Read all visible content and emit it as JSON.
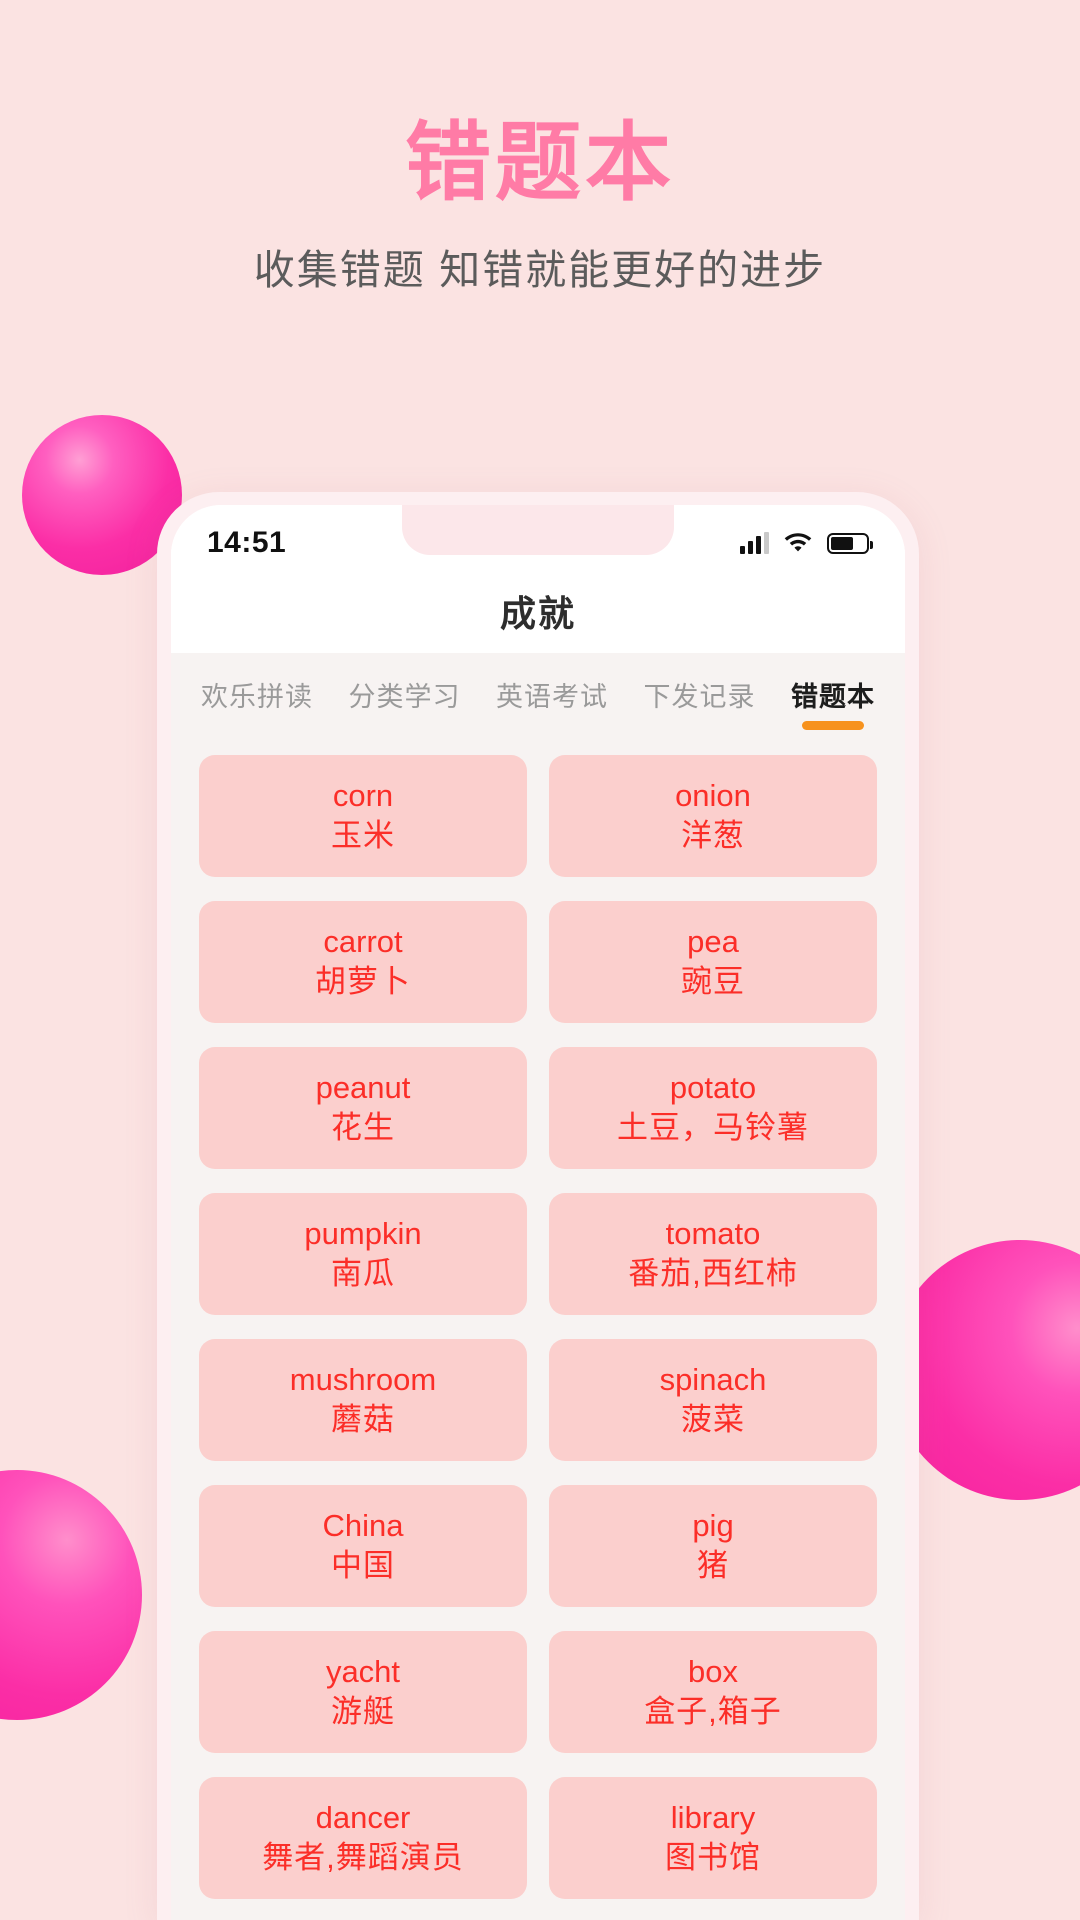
{
  "hero": {
    "title": "错题本",
    "subtitle": "收集错题  知错就能更好的进步",
    "title_color": "#ff7ba6",
    "background_color": "#fbe3e2"
  },
  "decor": {
    "sphere_color": "#fb2ea6",
    "spheres": [
      "sphere-top-left",
      "sphere-right",
      "sphere-bottom-left"
    ]
  },
  "phone": {
    "status_bar": {
      "time": "14:51",
      "signal_icon": "signal-bars-icon",
      "wifi_icon": "wifi-icon",
      "battery_icon": "battery-icon",
      "battery_level": "66%"
    },
    "nav": {
      "title": "成就"
    },
    "tabs": [
      {
        "label": "欢乐拼读",
        "active": false
      },
      {
        "label": "分类学习",
        "active": false
      },
      {
        "label": "英语考试",
        "active": false
      },
      {
        "label": "下发记录",
        "active": false
      },
      {
        "label": "错题本",
        "active": true
      }
    ],
    "tab_accent_color": "#f7921e",
    "card_color": "#fbcfcd",
    "card_text_color": "#fb2e28",
    "words": [
      {
        "en": "corn",
        "cn": "玉米"
      },
      {
        "en": "onion",
        "cn": "洋葱"
      },
      {
        "en": "carrot",
        "cn": "胡萝卜"
      },
      {
        "en": "pea",
        "cn": "豌豆"
      },
      {
        "en": "peanut",
        "cn": "花生"
      },
      {
        "en": "potato",
        "cn": "土豆，马铃薯"
      },
      {
        "en": "pumpkin",
        "cn": "南瓜"
      },
      {
        "en": "tomato",
        "cn": "番茄,西红柿"
      },
      {
        "en": "mushroom",
        "cn": "蘑菇"
      },
      {
        "en": "spinach",
        "cn": "菠菜"
      },
      {
        "en": "China",
        "cn": "中国"
      },
      {
        "en": "pig",
        "cn": "猪"
      },
      {
        "en": "yacht",
        "cn": "游艇"
      },
      {
        "en": "box",
        "cn": "盒子,箱子"
      },
      {
        "en": "dancer",
        "cn": "舞者,舞蹈演员"
      },
      {
        "en": "library",
        "cn": "图书馆"
      }
    ]
  }
}
